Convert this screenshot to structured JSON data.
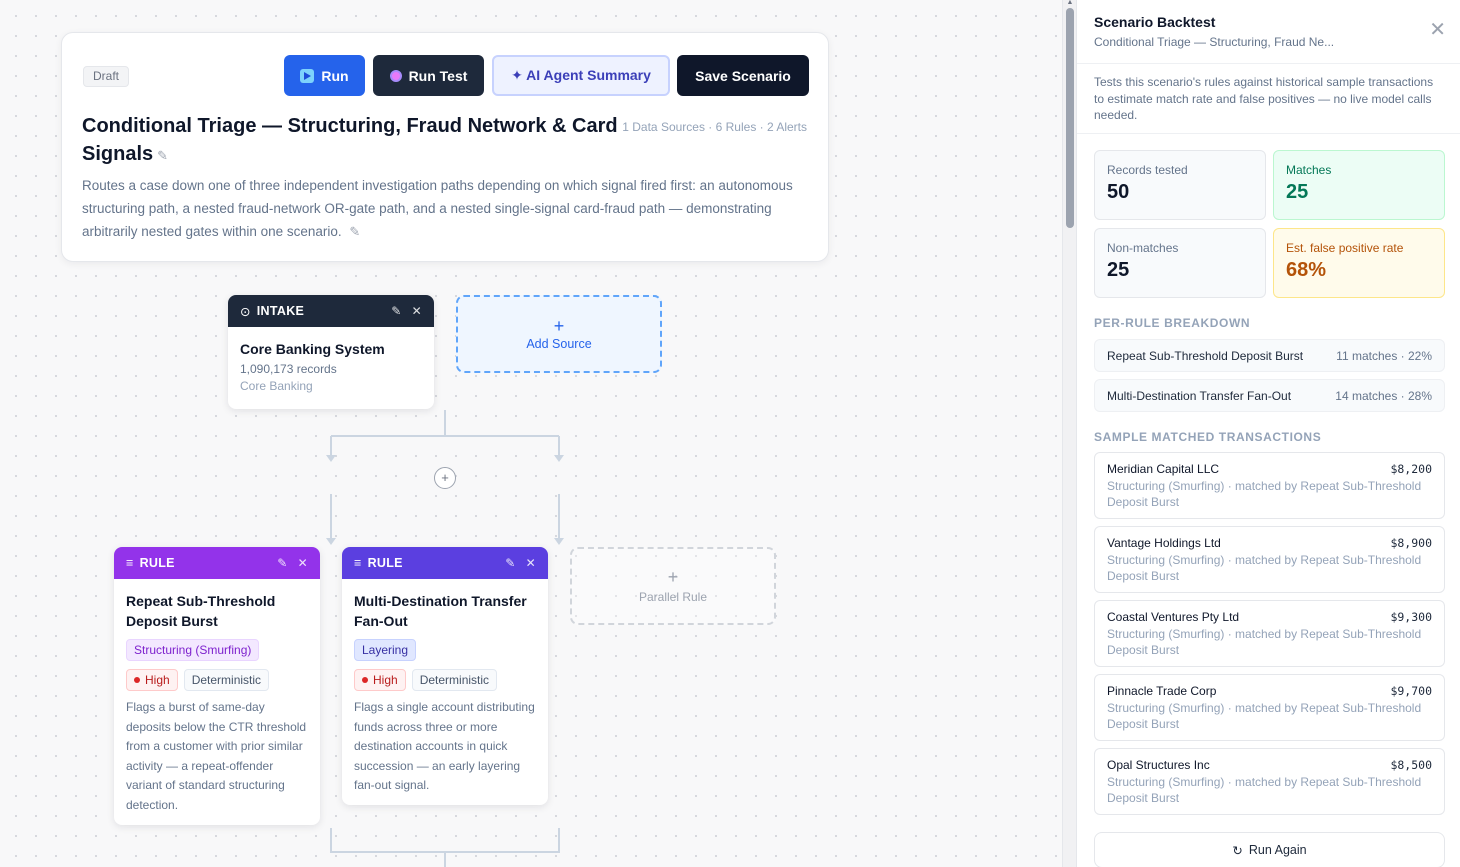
{
  "scenario": {
    "status_badge": "Draft",
    "title": "Conditional Triage — Structuring, Fraud Network & Card Signals",
    "meta": "1 Data Sources · 6 Rules · 2 Alerts",
    "description": "Routes a case down one of three independent investigation paths depending on which signal fired first: an autonomous structuring path, a nested fraud-network OR-gate path, and a nested single-signal card-fraud path — demonstrating arbitrarily nested gates within one scenario."
  },
  "toolbar": {
    "run_label": "Run",
    "run_test_label": "Run Test",
    "ai_summary_label": "✦ AI Agent Summary",
    "save_label": "Save Scenario"
  },
  "canvas": {
    "intake": {
      "header": "INTAKE",
      "title": "Core Banking System",
      "records": "1,090,173 records",
      "source_type": "Core Banking"
    },
    "add_source_label": "Add Source",
    "parallel_rule_label": "Parallel Rule",
    "rules": [
      {
        "header": "RULE",
        "title": "Repeat Sub-Threshold Deposit Burst",
        "typology": "Structuring (Smurfing)",
        "severity": "High",
        "method": "Deterministic",
        "description": "Flags a burst of same-day deposits below the CTR threshold from a customer with prior similar activity — a repeat-offender variant of standard structuring detection."
      },
      {
        "header": "RULE",
        "title": "Multi-Destination Transfer Fan-Out",
        "typology": "Layering",
        "severity": "High",
        "method": "Deterministic",
        "description": "Flags a single account distributing funds across three or more destination accounts in quick succession — an early layering fan-out signal."
      }
    ]
  },
  "panel": {
    "title": "Scenario Backtest",
    "subtitle": "Conditional Triage — Structuring, Fraud Ne...",
    "intro": "Tests this scenario's rules against historical sample transactions to estimate match rate and false positives — no live model calls needed.",
    "stats": {
      "records_tested_label": "Records tested",
      "records_tested": "50",
      "matches_label": "Matches",
      "matches": "25",
      "non_matches_label": "Non-matches",
      "non_matches": "25",
      "fp_rate_label": "Est. false positive rate",
      "fp_rate": "68%"
    },
    "breakdown_heading": "PER-RULE BREAKDOWN",
    "breakdown": [
      {
        "name": "Repeat Sub-Threshold Deposit Burst",
        "stat": "11 matches · 22%"
      },
      {
        "name": "Multi-Destination Transfer Fan-Out",
        "stat": "14 matches · 28%"
      }
    ],
    "samples_heading": "SAMPLE MATCHED TRANSACTIONS",
    "samples": [
      {
        "customer": "Meridian Capital LLC",
        "amount": "$8,200",
        "desc": "Structuring (Smurfing) · matched by Repeat Sub-Threshold Deposit Burst"
      },
      {
        "customer": "Vantage Holdings Ltd",
        "amount": "$8,900",
        "desc": "Structuring (Smurfing) · matched by Repeat Sub-Threshold Deposit Burst"
      },
      {
        "customer": "Coastal Ventures Pty Ltd",
        "amount": "$9,300",
        "desc": "Structuring (Smurfing) · matched by Repeat Sub-Threshold Deposit Burst"
      },
      {
        "customer": "Pinnacle Trade Corp",
        "amount": "$9,700",
        "desc": "Structuring (Smurfing) · matched by Repeat Sub-Threshold Deposit Burst"
      },
      {
        "customer": "Opal Structures Inc",
        "amount": "$8,500",
        "desc": "Structuring (Smurfing) · matched by Repeat Sub-Threshold Deposit Burst"
      }
    ],
    "run_again_label": "Run Again"
  }
}
